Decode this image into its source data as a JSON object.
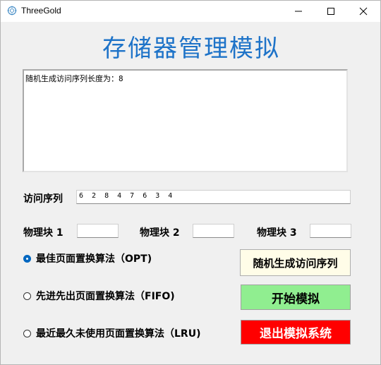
{
  "window": {
    "title": "ThreeGold",
    "controls": [
      "minimize",
      "maximize",
      "close"
    ]
  },
  "heading": "存储器管理模拟",
  "log": {
    "text": "随机生成访问序列长度为：8"
  },
  "sequence": {
    "label": "访问序列",
    "value": "6 2 8 4 7 6 3 4"
  },
  "blocks": [
    {
      "label": "物理块 1",
      "value": ""
    },
    {
      "label": "物理块 2",
      "value": ""
    },
    {
      "label": "物理块 3",
      "value": ""
    }
  ],
  "algorithms": [
    {
      "label": "最佳页面置换算法（OPT)",
      "selected": true
    },
    {
      "label": "先进先出页面置换算法（FIFO)",
      "selected": false
    },
    {
      "label": "最近最久未使用页面置换算法（LRU)",
      "selected": false
    }
  ],
  "buttons": {
    "generate": "随机生成访问序列",
    "start": "开始模拟",
    "exit": "退出模拟系统"
  },
  "colors": {
    "heading": "#1e73c8",
    "generate_bg": "#fffde8",
    "start_bg": "#90ee90",
    "exit_bg": "#ff0000",
    "radio_accent": "#0067c0"
  }
}
